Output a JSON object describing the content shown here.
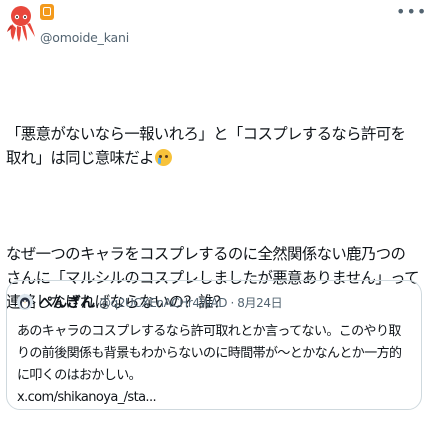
{
  "author": {
    "display_name_icon": "orange-emoji-icon",
    "handle": "@omoide_kani",
    "avatar_icon": "octopus-icon"
  },
  "tweet": {
    "para1_text": "「悪意がないなら一報いれろ」と「コスプレするなら許可を取れ」は同じ意味だよ",
    "para1_emoji": "crying-face-icon",
    "para2_text": "なぜ一つのキャラをコスプレするのに全然関係ない鹿乃つのさんに「マルシルのコスプレしましたが悪意ありません」って連絡しなければならないの？誰？"
  },
  "quoted_tweet": {
    "avatar_icon": "penguin-icon",
    "name": "ぺんぎん",
    "meta": "@q2UCXEnACHr4WAD · 8月24日",
    "text": "あのキャラのコスプレするなら許可取れとか言ってない。このやり取りの前後関係も背景もわからないのに時間帯が〜とかなんとか一方的に叩くのはおかしい。",
    "link": "x.com/shikanoya_/sta..."
  },
  "colors": {
    "text": "#0f1419",
    "secondary": "#536471",
    "border": "#cfd9de",
    "octopus": "#e8483c"
  }
}
